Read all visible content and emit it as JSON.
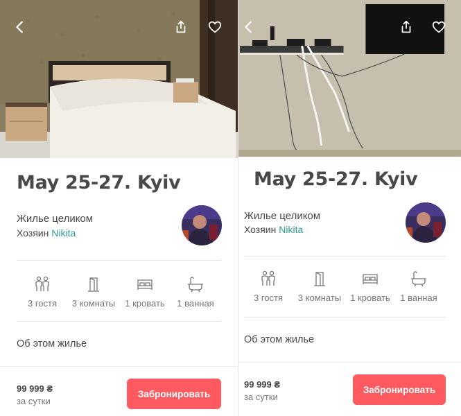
{
  "listing": {
    "title": "May 25-27. Kyiv",
    "home_type": "Жилье целиком",
    "host_prefix": "Хозяин ",
    "host_name": "Nikita"
  },
  "amenities": [
    {
      "icon": "guests-icon",
      "label": "3 гостя"
    },
    {
      "icon": "door-icon",
      "label": "3 комнаты"
    },
    {
      "icon": "bed-icon",
      "label": "1 кровать"
    },
    {
      "icon": "bathtub-icon",
      "label": "1 ванная"
    }
  ],
  "about_link": "Об этом жилье",
  "booking": {
    "price": "99 999 ₴",
    "per": "за сутки",
    "reserve_label": "Забронировать"
  },
  "photos": {
    "left": "bedroom-photo",
    "right": "tv-wall-photo"
  },
  "colors": {
    "accent": "#ff5a5f",
    "host_link": "#2e9c95",
    "text": "#484848",
    "muted": "#767676"
  }
}
